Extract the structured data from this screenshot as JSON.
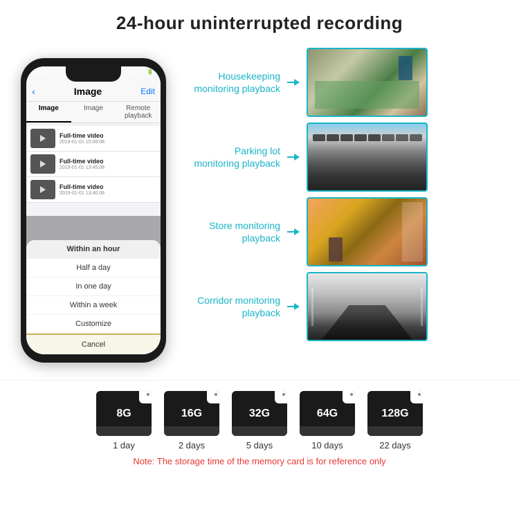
{
  "header": {
    "title": "24-hour uninterrupted recording"
  },
  "phone": {
    "time": "11:44",
    "screen_title": "Image",
    "back_label": "‹",
    "edit_label": "Edit",
    "tabs": [
      "Image",
      "Image",
      "Remote playback"
    ],
    "videos": [
      {
        "name": "Full-time video",
        "date": "2019-01-01 15:08:08"
      },
      {
        "name": "Full-time video",
        "date": "2019-01-01 13:45:08"
      },
      {
        "name": "Full-time video",
        "date": "2019-01-01 13:40:08"
      }
    ],
    "dropdown_items": [
      {
        "label": "Within an hour",
        "highlighted": true
      },
      {
        "label": "Half a day",
        "highlighted": false
      },
      {
        "label": "In one day",
        "highlighted": false
      },
      {
        "label": "Within a week",
        "highlighted": false
      },
      {
        "label": "Customize",
        "highlighted": false
      }
    ],
    "cancel_label": "Cancel"
  },
  "monitoring": [
    {
      "label": "Housekeeping\nmonitoring playback",
      "img_class": "img-housekeeping"
    },
    {
      "label": "Parking lot\nmonitoring playback",
      "img_class": "img-parking"
    },
    {
      "label": "Store monitoring\nplayback",
      "img_class": "img-store"
    },
    {
      "label": "Corridor monitoring\nplayback",
      "img_class": "img-corridor"
    }
  ],
  "sd_cards": [
    {
      "size": "8G",
      "days": "1 day"
    },
    {
      "size": "16G",
      "days": "2 days"
    },
    {
      "size": "32G",
      "days": "5 days"
    },
    {
      "size": "64G",
      "days": "10 days"
    },
    {
      "size": "128G",
      "days": "22 days"
    }
  ],
  "note": "Note: The storage time of the memory card is for reference only"
}
